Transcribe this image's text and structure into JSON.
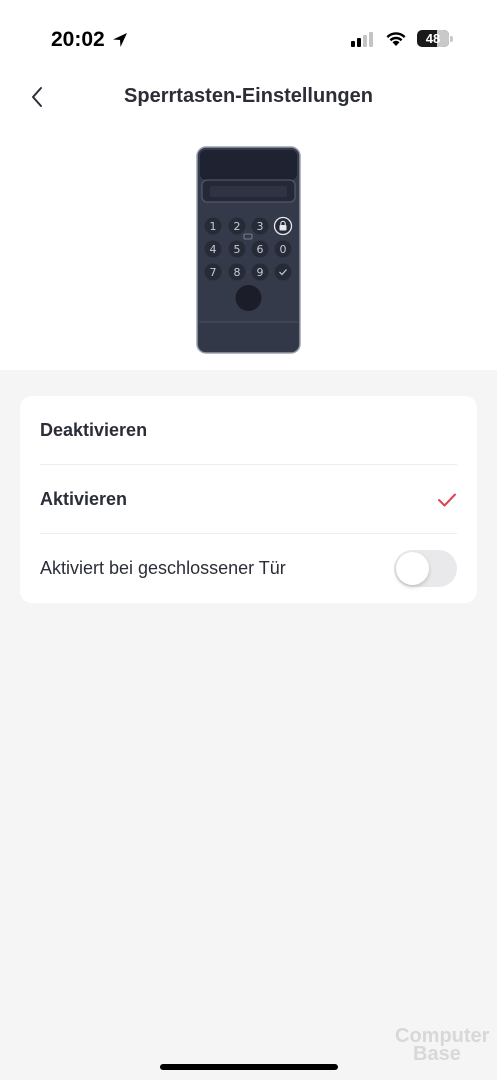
{
  "status_bar": {
    "time": "20:02",
    "battery": "48"
  },
  "header": {
    "title": "Sperrtasten-Einstellungen"
  },
  "device": {
    "keys": [
      "1",
      "2",
      "3",
      "4",
      "5",
      "6",
      "0",
      "7",
      "8",
      "9"
    ]
  },
  "settings": {
    "options": [
      {
        "label": "Deaktivieren",
        "selected": false
      },
      {
        "label": "Aktivieren",
        "selected": true
      }
    ],
    "closed_door_toggle": {
      "label": "Aktiviert bei geschlossener Tür",
      "enabled": false
    }
  },
  "colors": {
    "accent": "#e0434f",
    "background": "#f5f5f5",
    "card": "#ffffff",
    "text": "#2b2d38",
    "device_body": "#353a4a"
  },
  "watermark": {
    "line1": "Computer",
    "line2": "Base"
  }
}
